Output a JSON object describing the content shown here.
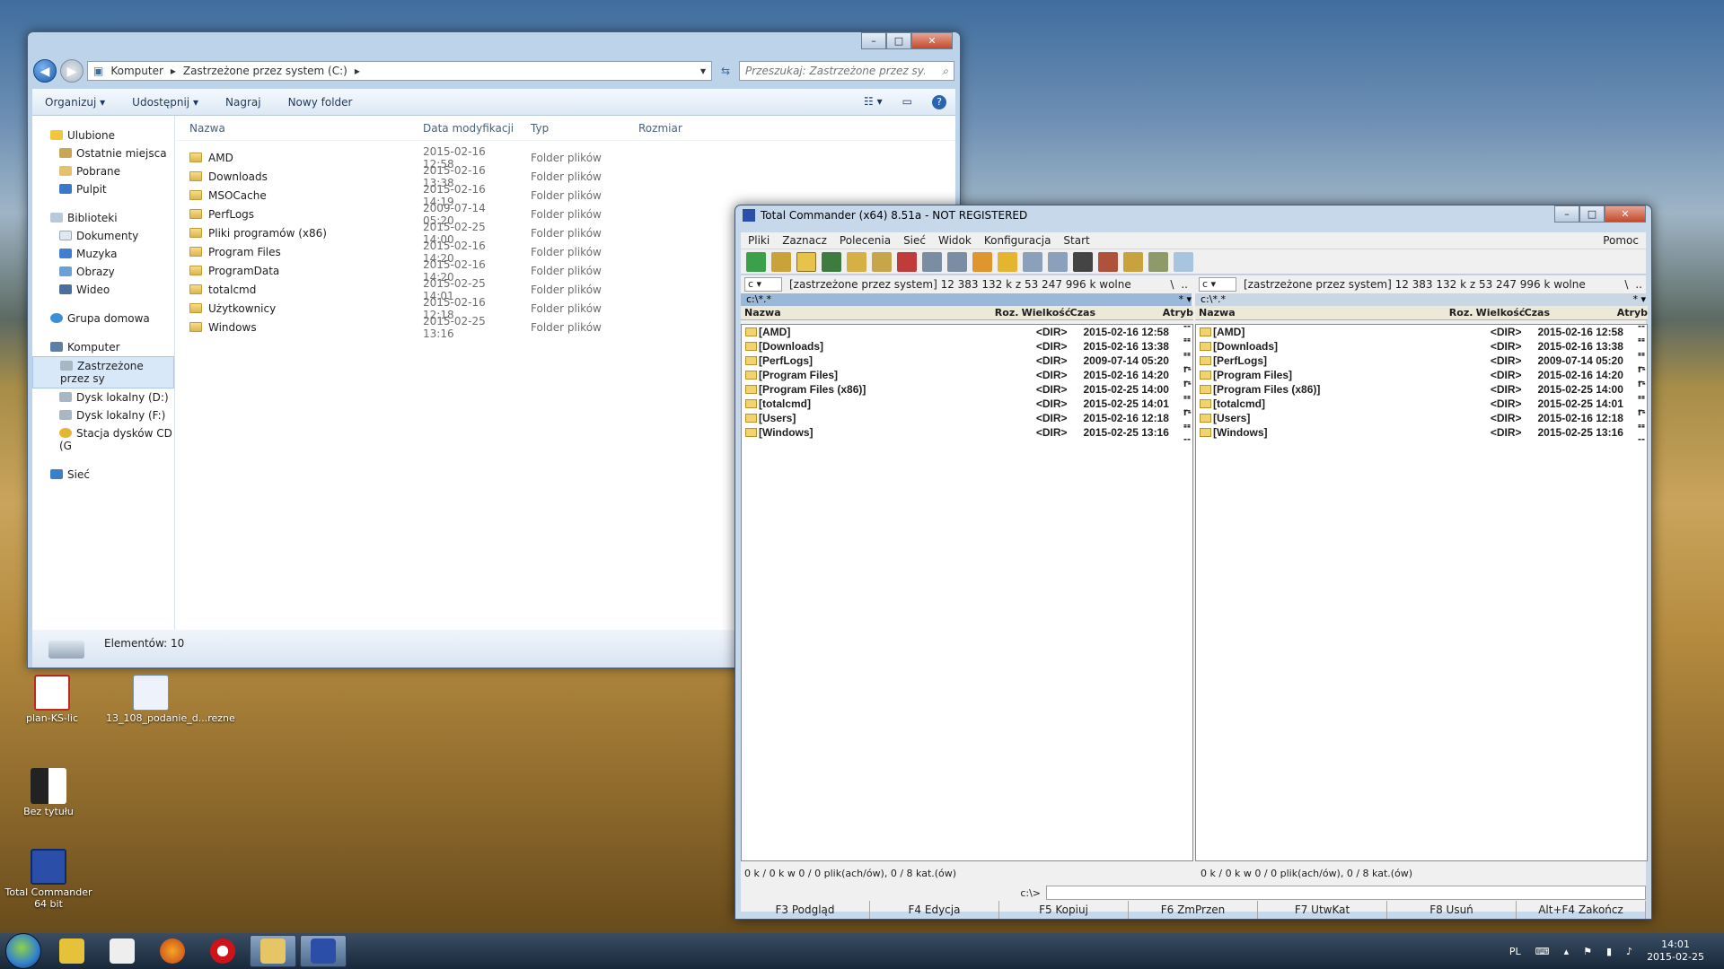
{
  "desktop": {
    "icons": [
      {
        "label": "plan-KS-lic"
      },
      {
        "label": "13_108_podanie_d...rezne"
      },
      {
        "label": "Bez tytułu"
      },
      {
        "label": "Total Commander 64 bit"
      }
    ]
  },
  "explorer": {
    "breadcrumb": [
      "Komputer",
      "Zastrzeżone przez system (C:)"
    ],
    "search_placeholder": "Przeszukaj: Zastrzeżone przez system (...",
    "toolbar": {
      "organize": "Organizuj",
      "share": "Udostępnij",
      "burn": "Nagraj",
      "new_folder": "Nowy folder"
    },
    "nav": {
      "favorites": "Ulubione",
      "recent": "Ostatnie miejsca",
      "downloads": "Pobrane",
      "desktop": "Pulpit",
      "libraries": "Biblioteki",
      "documents": "Dokumenty",
      "music": "Muzyka",
      "pictures": "Obrazy",
      "video": "Wideo",
      "homegroup": "Grupa domowa",
      "computer": "Komputer",
      "drive_c": "Zastrzeżone przez sy",
      "drive_d": "Dysk lokalny (D:)",
      "drive_f": "Dysk lokalny (F:)",
      "cd": "Stacja dysków CD (G",
      "network": "Sieć"
    },
    "columns": [
      "Nazwa",
      "Data modyfikacji",
      "Typ",
      "Rozmiar"
    ],
    "files": [
      {
        "name": "AMD",
        "date": "2015-02-16 12:58",
        "type": "Folder plików"
      },
      {
        "name": "Downloads",
        "date": "2015-02-16 13:38",
        "type": "Folder plików"
      },
      {
        "name": "MSOCache",
        "date": "2015-02-16 14:19",
        "type": "Folder plików"
      },
      {
        "name": "PerfLogs",
        "date": "2009-07-14 05:20",
        "type": "Folder plików"
      },
      {
        "name": "Pliki programów (x86)",
        "date": "2015-02-25 14:00",
        "type": "Folder plików"
      },
      {
        "name": "Program Files",
        "date": "2015-02-16 14:20",
        "type": "Folder plików"
      },
      {
        "name": "ProgramData",
        "date": "2015-02-16 14:20",
        "type": "Folder plików"
      },
      {
        "name": "totalcmd",
        "date": "2015-02-25 14:01",
        "type": "Folder plików"
      },
      {
        "name": "Użytkownicy",
        "date": "2015-02-16 12:18",
        "type": "Folder plików"
      },
      {
        "name": "Windows",
        "date": "2015-02-25 13:16",
        "type": "Folder plików"
      }
    ],
    "status": "Elementów: 10"
  },
  "tc": {
    "title": "Total Commander (x64) 8.51a - NOT REGISTERED",
    "menu": [
      "Pliki",
      "Zaznacz",
      "Polecenia",
      "Sieć",
      "Widok",
      "Konfiguracja",
      "Start"
    ],
    "help": "Pomoc",
    "drive": "c",
    "drive_info": "[zastrzeżone przez system]  12 383 132 k z 53 247 996 k wolne",
    "path": "c:\\*.*",
    "headers": [
      "Nazwa",
      "Roz.",
      "Wielkość",
      "Czas",
      "Atryb"
    ],
    "rows": [
      {
        "name": "[AMD]",
        "size": "<DIR>",
        "time": "2015-02-16 12:58",
        "attr": "----"
      },
      {
        "name": "[Downloads]",
        "size": "<DIR>",
        "time": "2015-02-16 13:38",
        "attr": "----"
      },
      {
        "name": "[PerfLogs]",
        "size": "<DIR>",
        "time": "2009-07-14 05:20",
        "attr": "----"
      },
      {
        "name": "[Program Files]",
        "size": "<DIR>",
        "time": "2015-02-16 14:20",
        "attr": "r---"
      },
      {
        "name": "[Program Files (x86)]",
        "size": "<DIR>",
        "time": "2015-02-25 14:00",
        "attr": "r---"
      },
      {
        "name": "[totalcmd]",
        "size": "<DIR>",
        "time": "2015-02-25 14:01",
        "attr": "----"
      },
      {
        "name": "[Users]",
        "size": "<DIR>",
        "time": "2015-02-16 12:18",
        "attr": "r---"
      },
      {
        "name": "[Windows]",
        "size": "<DIR>",
        "time": "2015-02-25 13:16",
        "attr": "----"
      }
    ],
    "status": "0 k / 0 k w 0 / 0 plik(ach/ów), 0 / 8 kat.(ów)",
    "cmd_prompt": "c:\\>",
    "fkeys": [
      "F3 Podgląd",
      "F4 Edycja",
      "F5 Kopiuj",
      "F6 ZmPrzen",
      "F7 UtwKat",
      "F8 Usuń",
      "Alt+F4 Zakończ"
    ]
  },
  "tray": {
    "lang": "PL",
    "time": "14:01",
    "date": "2015-02-25"
  }
}
